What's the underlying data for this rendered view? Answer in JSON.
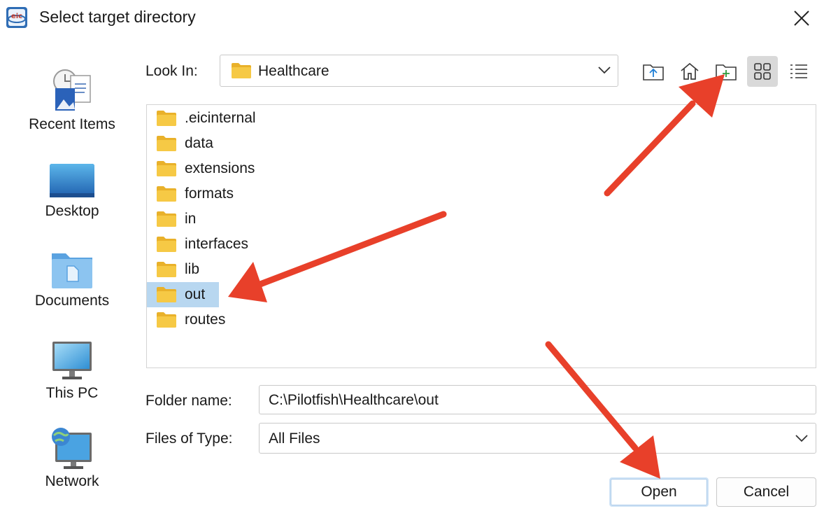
{
  "window": {
    "title": "Select target directory",
    "app_icon_text": "eic",
    "close_icon": "close-icon"
  },
  "places": [
    {
      "label": "Recent Items",
      "icon": "recent-items-icon"
    },
    {
      "label": "Desktop",
      "icon": "desktop-icon"
    },
    {
      "label": "Documents",
      "icon": "documents-icon"
    },
    {
      "label": "This PC",
      "icon": "this-pc-icon"
    },
    {
      "label": "Network",
      "icon": "network-icon"
    }
  ],
  "look_in": {
    "label": "Look In:",
    "value": "Healthcare"
  },
  "toolbar": {
    "up_icon": "folder-up-icon",
    "home_icon": "home-icon",
    "new_folder_icon": "new-folder-icon",
    "grid_view_icon": "grid-view-icon",
    "list_view_icon": "list-view-icon",
    "active_view": "grid"
  },
  "files": [
    {
      "name": ".eicinternal",
      "selected": false
    },
    {
      "name": "data",
      "selected": false
    },
    {
      "name": "extensions",
      "selected": false
    },
    {
      "name": "formats",
      "selected": false
    },
    {
      "name": "in",
      "selected": false
    },
    {
      "name": "interfaces",
      "selected": false
    },
    {
      "name": "lib",
      "selected": false
    },
    {
      "name": "out",
      "selected": true
    },
    {
      "name": "routes",
      "selected": false
    }
  ],
  "folder_name": {
    "label": "Folder name:",
    "value": "C:\\Pilotfish\\Healthcare\\out"
  },
  "files_of_type": {
    "label": "Files of Type:",
    "value": "All Files"
  },
  "buttons": {
    "open": "Open",
    "cancel": "Cancel"
  },
  "colors": {
    "selection": "#b8d7f0",
    "folder": "#f6c945",
    "annotation_arrow": "#e8402a"
  }
}
